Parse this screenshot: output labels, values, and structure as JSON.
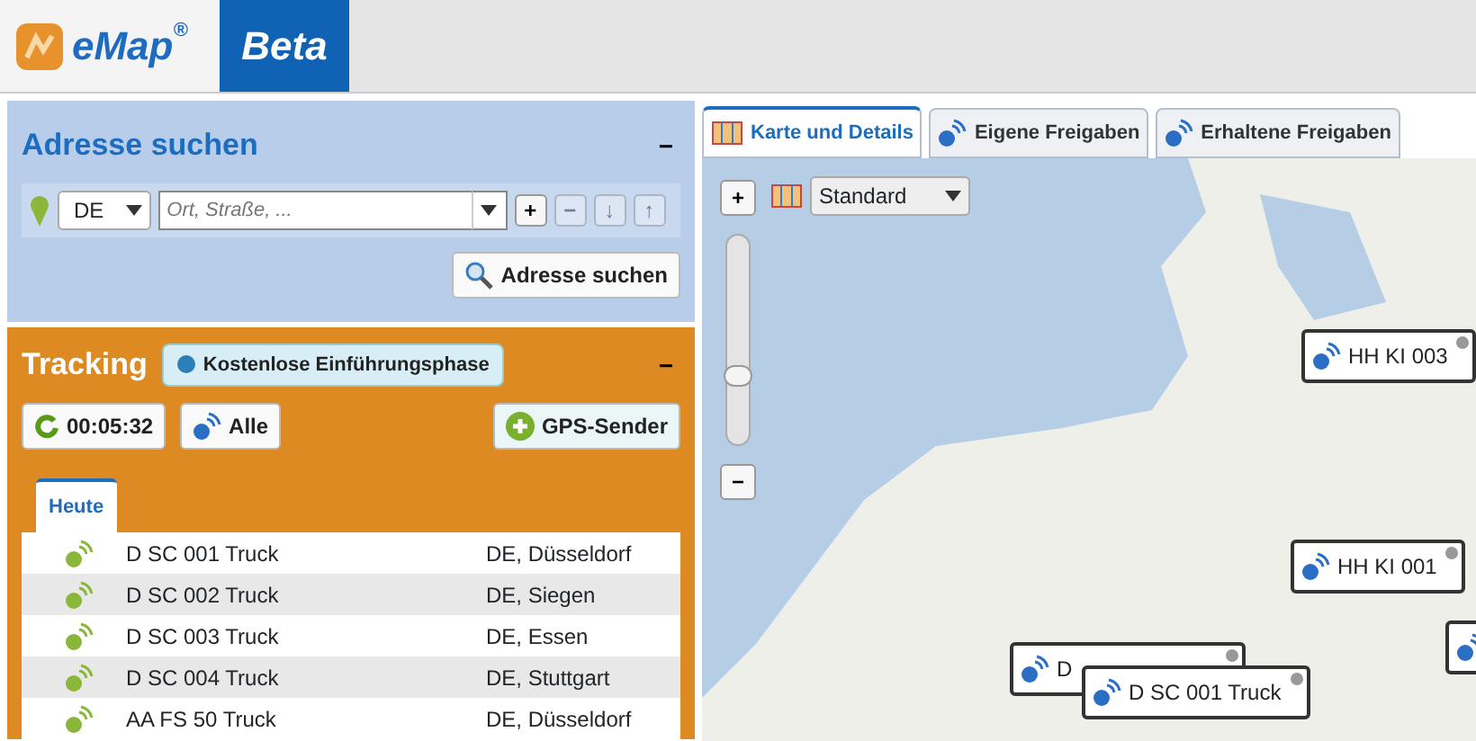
{
  "header": {
    "logo_text": "eMap",
    "logo_mark": "®",
    "badge": "Beta"
  },
  "address_panel": {
    "title": "Adresse suchen",
    "collapse": "−",
    "country": "DE",
    "placeholder": "Ort, Straße, ...",
    "row_buttons": [
      {
        "symbol": "+",
        "disabled": false
      },
      {
        "symbol": "−",
        "disabled": true
      },
      {
        "symbol": "↓",
        "disabled": true
      },
      {
        "symbol": "↑",
        "disabled": true
      }
    ],
    "search_button": "Adresse suchen"
  },
  "tracking_panel": {
    "title": "Tracking",
    "collapse": "−",
    "notice": "Kostenlose Einführungsphase",
    "timer": "00:05:32",
    "all_button": "Alle",
    "add_button": "GPS-Sender",
    "tabs": [
      {
        "label": "Heute",
        "selected": true
      }
    ],
    "rows": [
      {
        "name": "D SC 001 Truck",
        "location": "DE, Düsseldorf"
      },
      {
        "name": "D SC 002 Truck",
        "location": "DE, Siegen"
      },
      {
        "name": "D SC 003 Truck",
        "location": "DE, Essen"
      },
      {
        "name": "D SC 004 Truck",
        "location": "DE, Stuttgart"
      },
      {
        "name": "AA FS 50 Truck",
        "location": "DE, Düsseldorf"
      }
    ]
  },
  "map_tabs": [
    {
      "label": "Karte und Details",
      "selected": true
    },
    {
      "label": "Eigene Freigaben",
      "selected": false
    },
    {
      "label": "Erhaltene Freigaben",
      "selected": false
    }
  ],
  "map": {
    "zoom_in": "+",
    "zoom_out": "−",
    "level": 0.31,
    "layer": "Standard",
    "markers": [
      {
        "kind": "labelled",
        "label": "HH KI 003"
      },
      {
        "kind": "labelled",
        "label": "HH KI 001"
      },
      {
        "kind": "labelled",
        "label": "D"
      },
      {
        "kind": "labelled",
        "label": "D SC 001 Truck"
      },
      {
        "kind": "icon"
      }
    ]
  }
}
